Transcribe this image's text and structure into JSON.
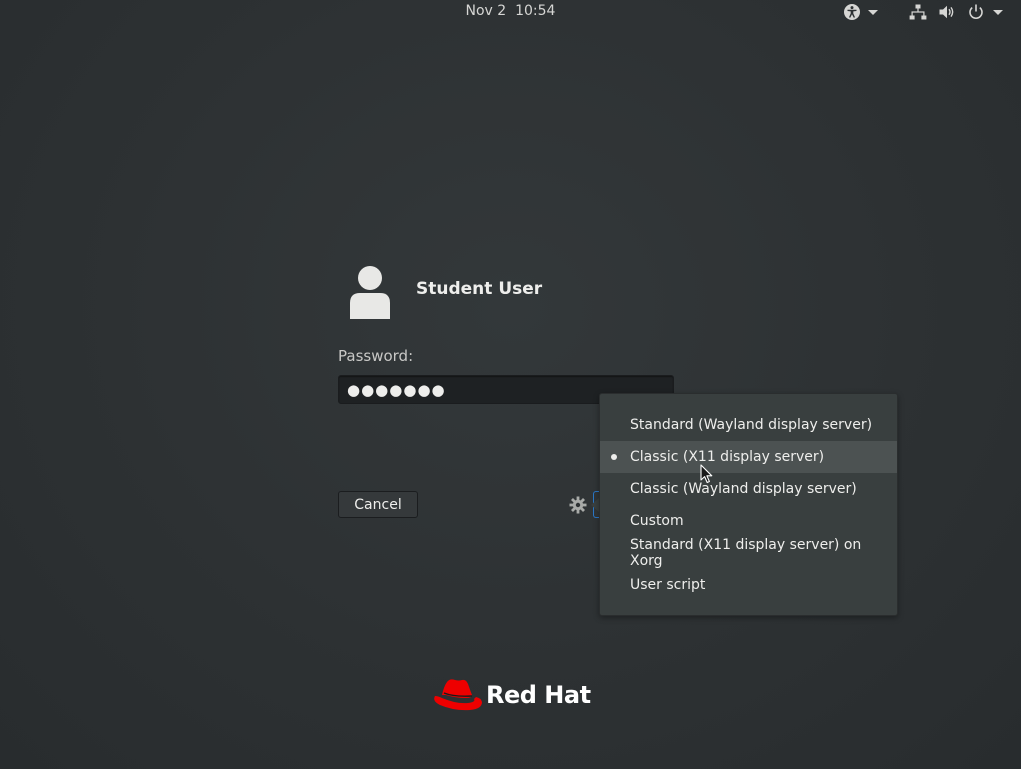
{
  "topbar": {
    "date": "Nov 2",
    "time": "10:54",
    "accessibility_icon": "accessibility-icon",
    "network_icon": "network-wired-icon",
    "volume_icon": "volume-icon",
    "power_icon": "power-icon"
  },
  "login": {
    "username": "Student User",
    "password_label": "Password:",
    "password_value": "●●●●●●●",
    "cancel_label": "Cancel"
  },
  "session_menu": {
    "items": [
      {
        "label": "Standard (Wayland display server)",
        "selected": false
      },
      {
        "label": "Classic (X11 display server)",
        "selected": true
      },
      {
        "label": "Classic (Wayland display server)",
        "selected": false
      },
      {
        "label": "Custom",
        "selected": false
      },
      {
        "label": "Standard (X11 display server) on Xorg",
        "selected": false
      },
      {
        "label": "User script",
        "selected": false
      }
    ]
  },
  "branding": {
    "logo_text": "Red Hat",
    "accent_color": "#ee0000"
  }
}
